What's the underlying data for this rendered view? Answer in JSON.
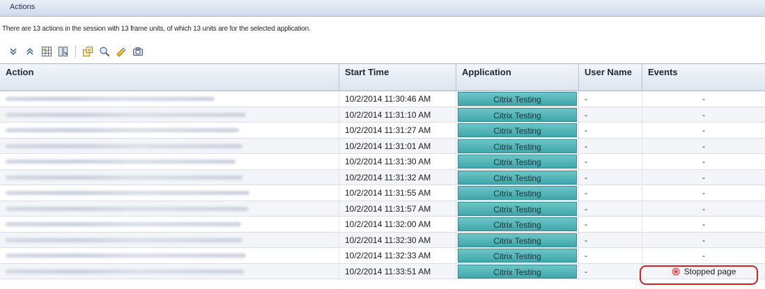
{
  "panel": {
    "title": "Actions",
    "summary": "There are 13 actions in the session with 13 frame units, of which 13 units are for the selected application."
  },
  "toolbar": {
    "buttons": [
      "expand-all",
      "collapse-all",
      "grid",
      "columns",
      "export",
      "search",
      "highlight",
      "snapshot"
    ]
  },
  "table": {
    "columns": [
      "Action",
      "Start Time",
      "Application",
      "User Name",
      "Events"
    ],
    "rows": [
      {
        "start_time": "10/2/2014 11:30:46 AM",
        "application": "Citrix Testing",
        "user": "-",
        "events": "-"
      },
      {
        "start_time": "10/2/2014 11:31:10 AM",
        "application": "Citrix Testing",
        "user": "-",
        "events": "-"
      },
      {
        "start_time": "10/2/2014 11:31:27 AM",
        "application": "Citrix Testing",
        "user": "-",
        "events": "-"
      },
      {
        "start_time": "10/2/2014 11:31:01 AM",
        "application": "Citrix Testing",
        "user": "-",
        "events": "-"
      },
      {
        "start_time": "10/2/2014 11:31:30 AM",
        "application": "Citrix Testing",
        "user": "-",
        "events": "-"
      },
      {
        "start_time": "10/2/2014 11:31:32 AM",
        "application": "Citrix Testing",
        "user": "-",
        "events": "-"
      },
      {
        "start_time": "10/2/2014 11:31:55 AM",
        "application": "Citrix Testing",
        "user": "-",
        "events": "-"
      },
      {
        "start_time": "10/2/2014 11:31:57 AM",
        "application": "Citrix Testing",
        "user": "-",
        "events": "-"
      },
      {
        "start_time": "10/2/2014 11:32:00 AM",
        "application": "Citrix Testing",
        "user": "-",
        "events": "-"
      },
      {
        "start_time": "10/2/2014 11:32:30 AM",
        "application": "Citrix Testing",
        "user": "-",
        "events": "-"
      },
      {
        "start_time": "10/2/2014 11:32:33 AM",
        "application": "Citrix Testing",
        "user": "-",
        "events": "-"
      },
      {
        "start_time": "10/2/2014 11:33:51 AM",
        "application": "Citrix Testing",
        "user": "-",
        "events": "Stopped page"
      }
    ]
  },
  "colors": {
    "app_fill": "#4fb3b6",
    "highlight": "#d21f1f",
    "stop_icon": "#e05a5a"
  }
}
